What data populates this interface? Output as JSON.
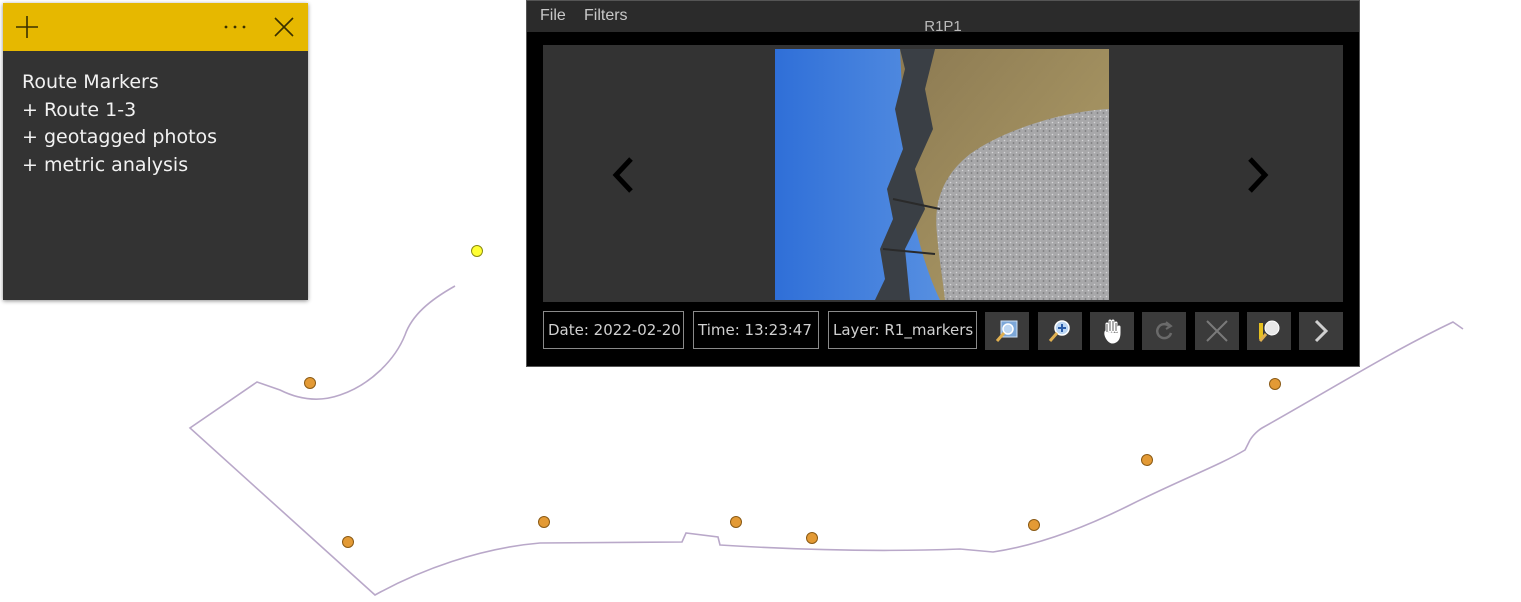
{
  "note": {
    "lines": [
      "Route Markers",
      "+ Route 1-3",
      "+ geotagged photos",
      "+ metric analysis"
    ],
    "color": "#e6b800"
  },
  "viewer": {
    "menu": [
      "File",
      "Filters"
    ],
    "title": "R1P1",
    "date": "Date: 2022-02-20",
    "time": "Time: 13:23:47",
    "layer": "Layer: R1_markers",
    "tools": [
      "zoom-extent-icon",
      "zoom-in-icon",
      "pan-hand-icon",
      "rotate-icon",
      "clear-selection-icon",
      "identify-feature-icon",
      "next-arrow-icon"
    ]
  },
  "map": {
    "route_color": "#b9a8c9",
    "marker_color": "#e39a35",
    "selected_marker_color": "#ffff33"
  }
}
